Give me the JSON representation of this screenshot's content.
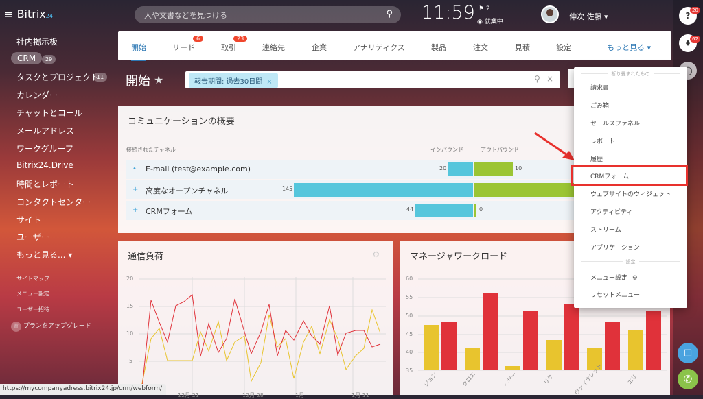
{
  "app": {
    "logo_name": "Bitrix",
    "logo_num": "24",
    "menu_glyph": "≡"
  },
  "search": {
    "placeholder": "人や文書などを見つける",
    "icon": "search-icon"
  },
  "clock": "11:59",
  "flag_count": "2",
  "status": "就業中",
  "user": {
    "name": "伸次 佐藤"
  },
  "rail": {
    "help_count": "20",
    "notify_count": "62"
  },
  "sidebar": {
    "items": [
      "社内掲示板",
      "CRM",
      "タスクとプロジェクト",
      "カレンダー",
      "チャットとコール",
      "メールアドレス",
      "ワークグループ",
      "Bitrix24.Drive",
      "時間とレポート",
      "コンタクトセンター",
      "サイト",
      "ユーザー",
      "もっと見る..."
    ],
    "crm_count": "29",
    "tasks_count": "11",
    "small": [
      "サイトマップ",
      "メニュー設定",
      "ユーザー招待"
    ],
    "upgrade": "プランをアップグレード"
  },
  "tabs": [
    {
      "label": "開始"
    },
    {
      "label": "リード",
      "badge": "6"
    },
    {
      "label": "取引",
      "badge": "23"
    },
    {
      "label": "連絡先"
    },
    {
      "label": "企業"
    },
    {
      "label": "アナリティクス"
    },
    {
      "label": "製品"
    },
    {
      "label": "注文"
    },
    {
      "label": "見積"
    },
    {
      "label": "設定"
    },
    {
      "label": "もっと見る"
    }
  ],
  "page": {
    "title": "開始",
    "filter_chip": "報告期間: 過去30日間"
  },
  "comm": {
    "title": "コミュニケーションの概要",
    "col_channel": "接続されたチャネル",
    "col_in": "インバウンド",
    "col_out": "アウトバウンド",
    "rows": [
      {
        "name": "E-mail (test@example.com)",
        "in": 20,
        "out": 10
      },
      {
        "name": "高度なオープンチャネル",
        "in": 145,
        "out": 145
      },
      {
        "name": "CRMフォーム",
        "in": 44,
        "out": 0
      }
    ]
  },
  "load": {
    "title": "通信負荷",
    "y_ticks": [
      "20",
      "15",
      "10",
      "5"
    ],
    "x_ticks": [
      "12月 21",
      "12月 28",
      "1月",
      "1月 11"
    ]
  },
  "workload": {
    "title": "マネージャワークロード",
    "y_ticks": [
      "60",
      "55",
      "50",
      "45",
      "40",
      "35"
    ],
    "x_ticks": [
      "ジョン",
      "クロエ",
      "ヘザー",
      "リサ",
      "ヴァイオレット",
      "エリ"
    ]
  },
  "menu": {
    "section1": "折り畳まれたもの",
    "items": [
      "請求書",
      "ごみ箱",
      "セールスファネル",
      "レポート",
      "履歴",
      "CRMフォーム",
      "ウェブサイトのウィジェット",
      "アクティビティ",
      "ストリーム",
      "アプリケーション"
    ],
    "section2": "設定",
    "settings": "メニュー設定",
    "reset": "リセットメニュー"
  },
  "status_url": "https://mycompanyadress.bitrix24.jp/crm/webform/",
  "colors": {
    "accent": "#2d78b4",
    "highlight": "#e8312d",
    "inbound": "#55c6dc",
    "outbound": "#9bc534",
    "bar_yellow": "#e8c42e",
    "bar_red": "#e0323a"
  }
}
